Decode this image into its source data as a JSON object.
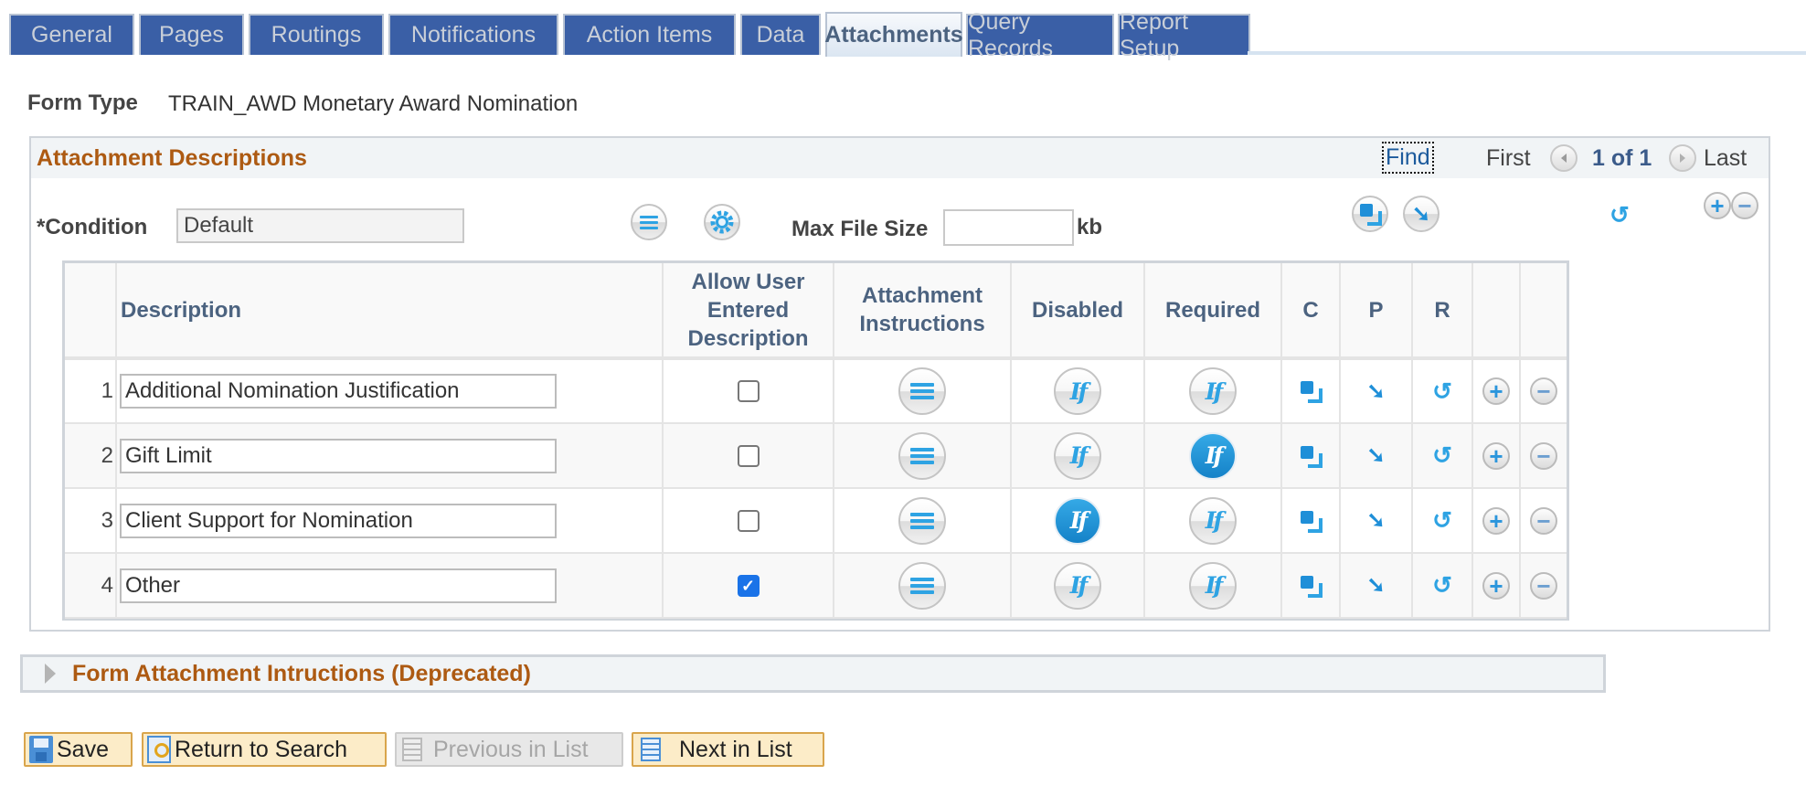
{
  "tabs": [
    {
      "label": "General",
      "active": false
    },
    {
      "label": "Pages",
      "active": false
    },
    {
      "label": "Routings",
      "active": false
    },
    {
      "label": "Notifications",
      "active": false
    },
    {
      "label": "Action Items",
      "active": false
    },
    {
      "label": "Data",
      "active": false
    },
    {
      "label": "Attachments",
      "active": true
    },
    {
      "label": "Query Records",
      "active": false
    },
    {
      "label": "Report Setup",
      "active": false
    }
  ],
  "form_type": {
    "label": "Form Type",
    "value": "TRAIN_AWD Monetary Award Nomination"
  },
  "panel": {
    "title": "Attachment Descriptions",
    "find_label": "Find",
    "nav": {
      "first": "First",
      "count": "1 of 1",
      "last": "Last",
      "prev_icon": "left-arrow-icon",
      "next_icon": "right-arrow-icon"
    },
    "condition": {
      "label": "*Condition",
      "value": "Default"
    },
    "max_file_size": {
      "label": "Max File Size",
      "value": "",
      "unit": "kb"
    },
    "group_toolbar": [
      "copy-icon",
      "paste-icon",
      "reset-icon",
      "add-icon",
      "delete-icon"
    ]
  },
  "grid": {
    "columns": [
      "",
      "Description",
      "Allow User Entered Description",
      "Attachment Instructions",
      "Disabled",
      "Required",
      "C",
      "P",
      "R",
      "",
      ""
    ],
    "column_lines": {
      "allow": [
        "Allow User",
        "Entered",
        "Description"
      ],
      "instructions": [
        "Attachment",
        "Instructions"
      ]
    },
    "rows": [
      {
        "num": "1",
        "description": "Additional Nomination Justification",
        "allow_user_entered": false,
        "disabled_active": false,
        "required_active": false
      },
      {
        "num": "2",
        "description": "Gift Limit",
        "allow_user_entered": false,
        "disabled_active": false,
        "required_active": true
      },
      {
        "num": "3",
        "description": "Client Support for Nomination",
        "allow_user_entered": false,
        "disabled_active": true,
        "required_active": false
      },
      {
        "num": "4",
        "description": "Other",
        "allow_user_entered": true,
        "disabled_active": false,
        "required_active": false
      }
    ],
    "if_glyph": "If",
    "check_glyph": "✓",
    "paste_glyph": "➘",
    "reset_glyph": "↺",
    "plus_glyph": "+",
    "minus_glyph": "−"
  },
  "deprecated_panel": {
    "title": "Form Attachment Intructions (Deprecated)",
    "collapsed": true
  },
  "buttons": {
    "save": "Save",
    "return_to_search": "Return to Search",
    "previous_in_list": "Previous in List",
    "next_in_list": "Next in List"
  },
  "colors": {
    "tab_bg": "#3a5fa6",
    "section_title": "#ad5a12",
    "header_text": "#4c6380",
    "icon_blue": "#2ea3e3",
    "button_bg": "#fcecc8",
    "button_border": "#d9a54c"
  }
}
